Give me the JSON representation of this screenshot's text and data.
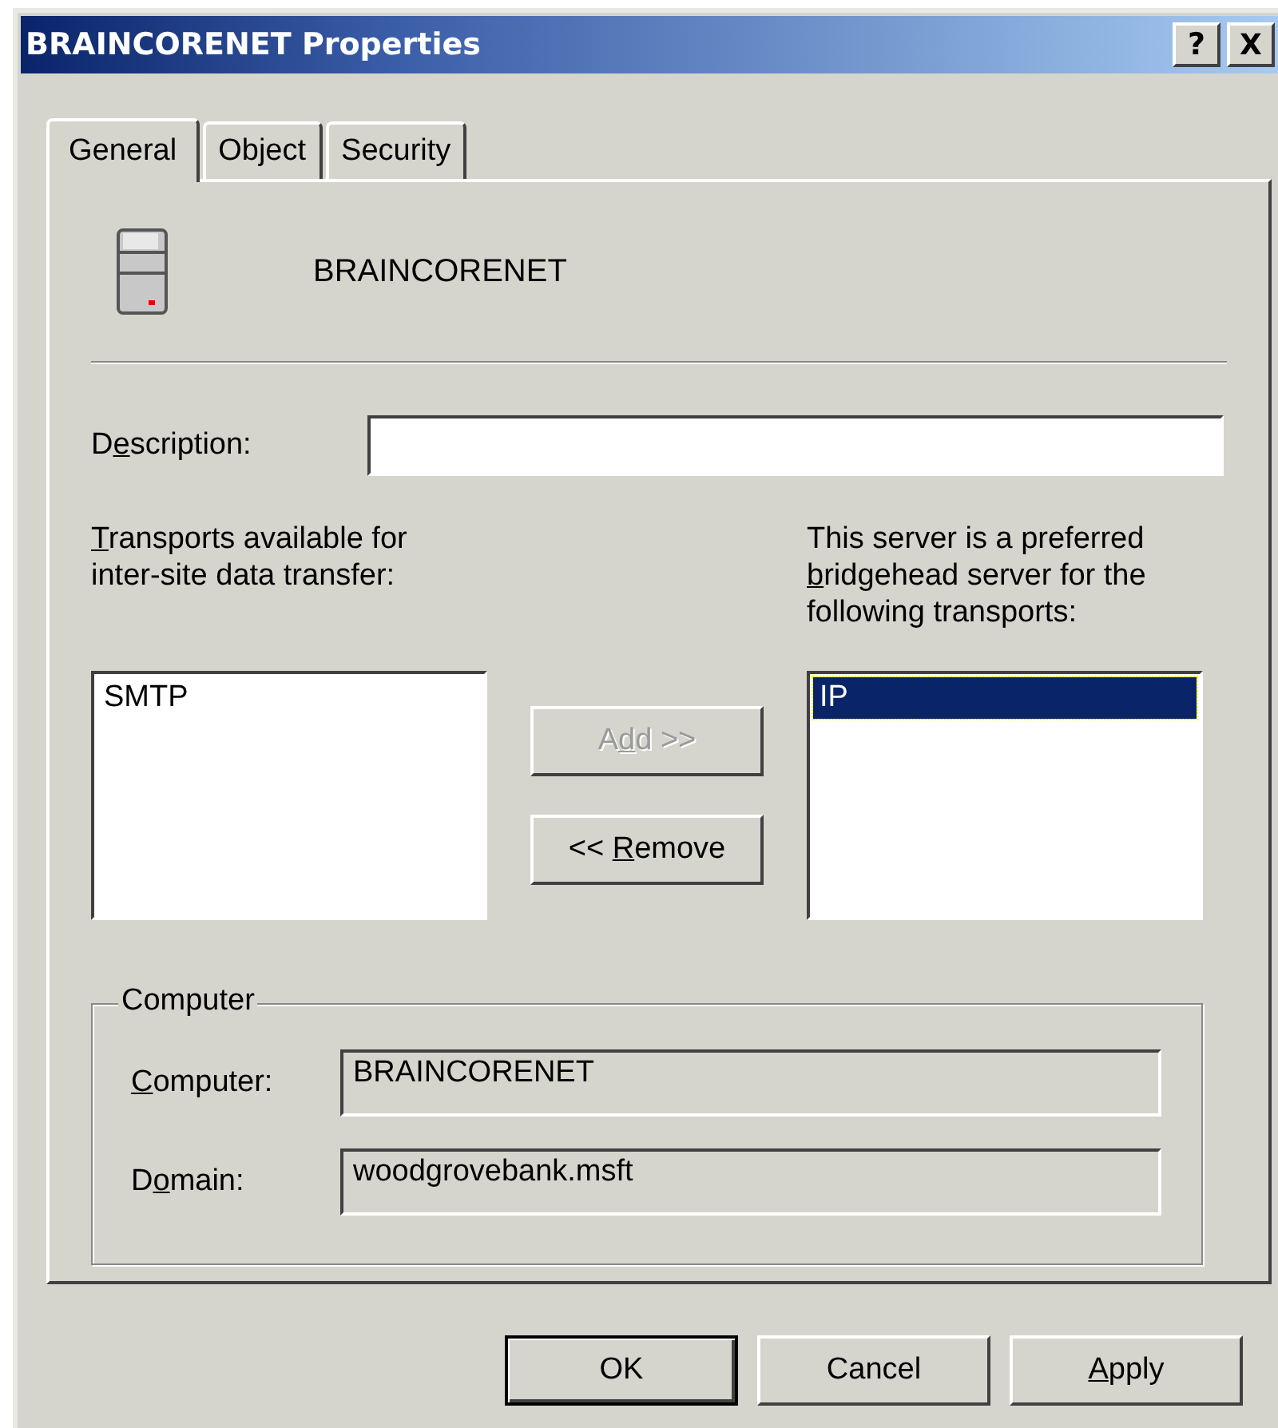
{
  "window": {
    "title": "BRAINCORENET Properties",
    "buttons": [
      {
        "kind": "help",
        "label": "?"
      },
      {
        "kind": "close",
        "label": "X"
      }
    ]
  },
  "tabs": [
    {
      "label": "General",
      "selected": true
    },
    {
      "label": "Object",
      "selected": false
    },
    {
      "label": "Security",
      "selected": false
    }
  ],
  "header": {
    "name": "BRAINCORENET"
  },
  "description": {
    "label": {
      "before": "D",
      "key": "e",
      "after": "scription:"
    }
  },
  "available": {
    "label": [
      {
        "key": "T",
        "after": "ransports available for"
      },
      {
        "before": "inter-site data transfer:"
      }
    ],
    "items": [
      {
        "label": "SMTP",
        "selected": false
      }
    ]
  },
  "preferred": {
    "label": [
      {
        "before": "This server is a preferred"
      },
      {
        "key": "b",
        "after": "ridgehead server for the"
      },
      {
        "before": "following transports:"
      }
    ],
    "items": [
      {
        "label": "IP",
        "selected": true
      }
    ]
  },
  "move_buttons": [
    {
      "label": {
        "before": "A",
        "key": "d",
        "after": "d >>"
      },
      "disabled": true
    },
    {
      "label": {
        "before": "<< ",
        "key": "R",
        "after": "emove"
      },
      "disabled": false
    }
  ],
  "computer_group": {
    "legend": "Computer",
    "fields": [
      {
        "label": {
          "key": "C",
          "after": "omputer:"
        },
        "value": "BRAINCORENET"
      },
      {
        "label": {
          "before": "D",
          "key": "o",
          "after": "main:"
        },
        "value": "woodgrovebank.msft"
      }
    ]
  },
  "dialog_buttons": [
    {
      "label": {
        "before": "OK"
      },
      "default": true
    },
    {
      "label": {
        "before": "Cancel"
      },
      "default": false
    },
    {
      "label": {
        "key": "A",
        "after": "pply"
      },
      "default": false
    }
  ]
}
